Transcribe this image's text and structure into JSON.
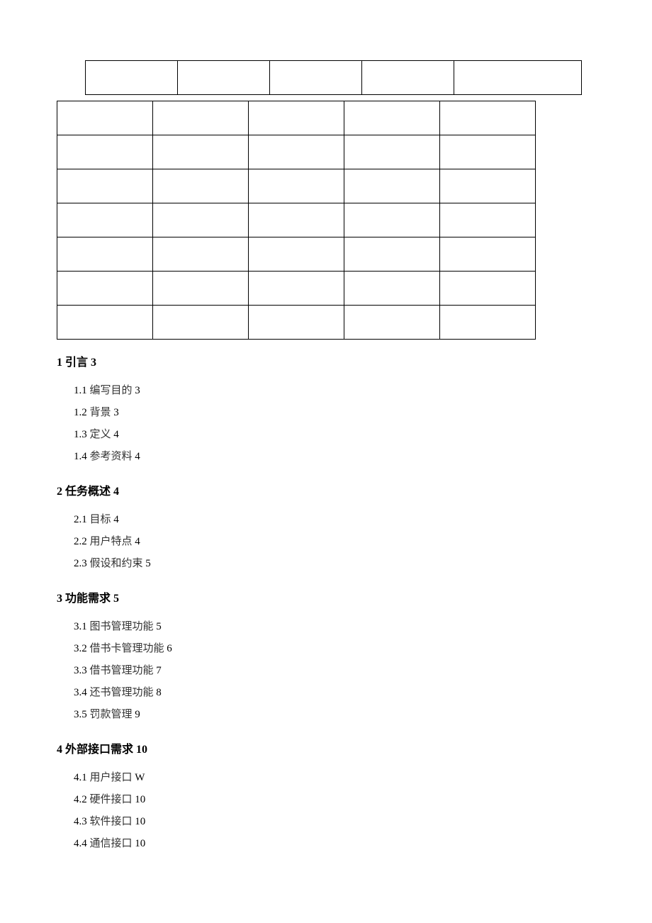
{
  "sections": [
    {
      "heading_num": "1",
      "heading_label": "引言",
      "heading_page": "3",
      "items": [
        {
          "num": "1.1",
          "label": "编写目的",
          "page": "3"
        },
        {
          "num": "1.2",
          "label": "背景",
          "page": "3"
        },
        {
          "num": "1.3",
          "label": "定义",
          "page": "4"
        },
        {
          "num": "1.4",
          "label": "参考资料",
          "page": "4"
        }
      ]
    },
    {
      "heading_num": "2",
      "heading_label": "任务概述",
      "heading_page": "4",
      "items": [
        {
          "num": "2.1",
          "label": "目标",
          "page": "4"
        },
        {
          "num": "2.2",
          "label": "用户特点",
          "page": "4"
        },
        {
          "num": "2.3",
          "label": "假设和约束",
          "page": "5"
        }
      ]
    },
    {
      "heading_num": "3",
      "heading_label": "功能需求",
      "heading_page": "5",
      "items": [
        {
          "num": "3.1",
          "label": "图书管理功能",
          "page": "5"
        },
        {
          "num": "3.2",
          "label": "借书卡管理功能",
          "page": "6"
        },
        {
          "num": "3.3",
          "label": "借书管理功能",
          "page": "7"
        },
        {
          "num": "3.4",
          "label": "还书管理功能",
          "page": "8"
        },
        {
          "num": "3.5",
          "label": "罚款管理",
          "page": "9"
        }
      ]
    },
    {
      "heading_num": "4",
      "heading_label": "外部接口需求",
      "heading_page": "10",
      "items": [
        {
          "num": "4.1",
          "label": "用户接口",
          "page": "W"
        },
        {
          "num": "4.2",
          "label": "硬件接口",
          "page": "10"
        },
        {
          "num": "4.3",
          "label": "软件接口",
          "page": "10"
        },
        {
          "num": "4.4",
          "label": "通信接口",
          "page": "10"
        }
      ]
    }
  ],
  "table1_cols": [
    130,
    130,
    130,
    130,
    180
  ],
  "table2_cols": [
    135,
    135,
    135,
    135,
    135,
    30
  ],
  "table2_rows": 6
}
